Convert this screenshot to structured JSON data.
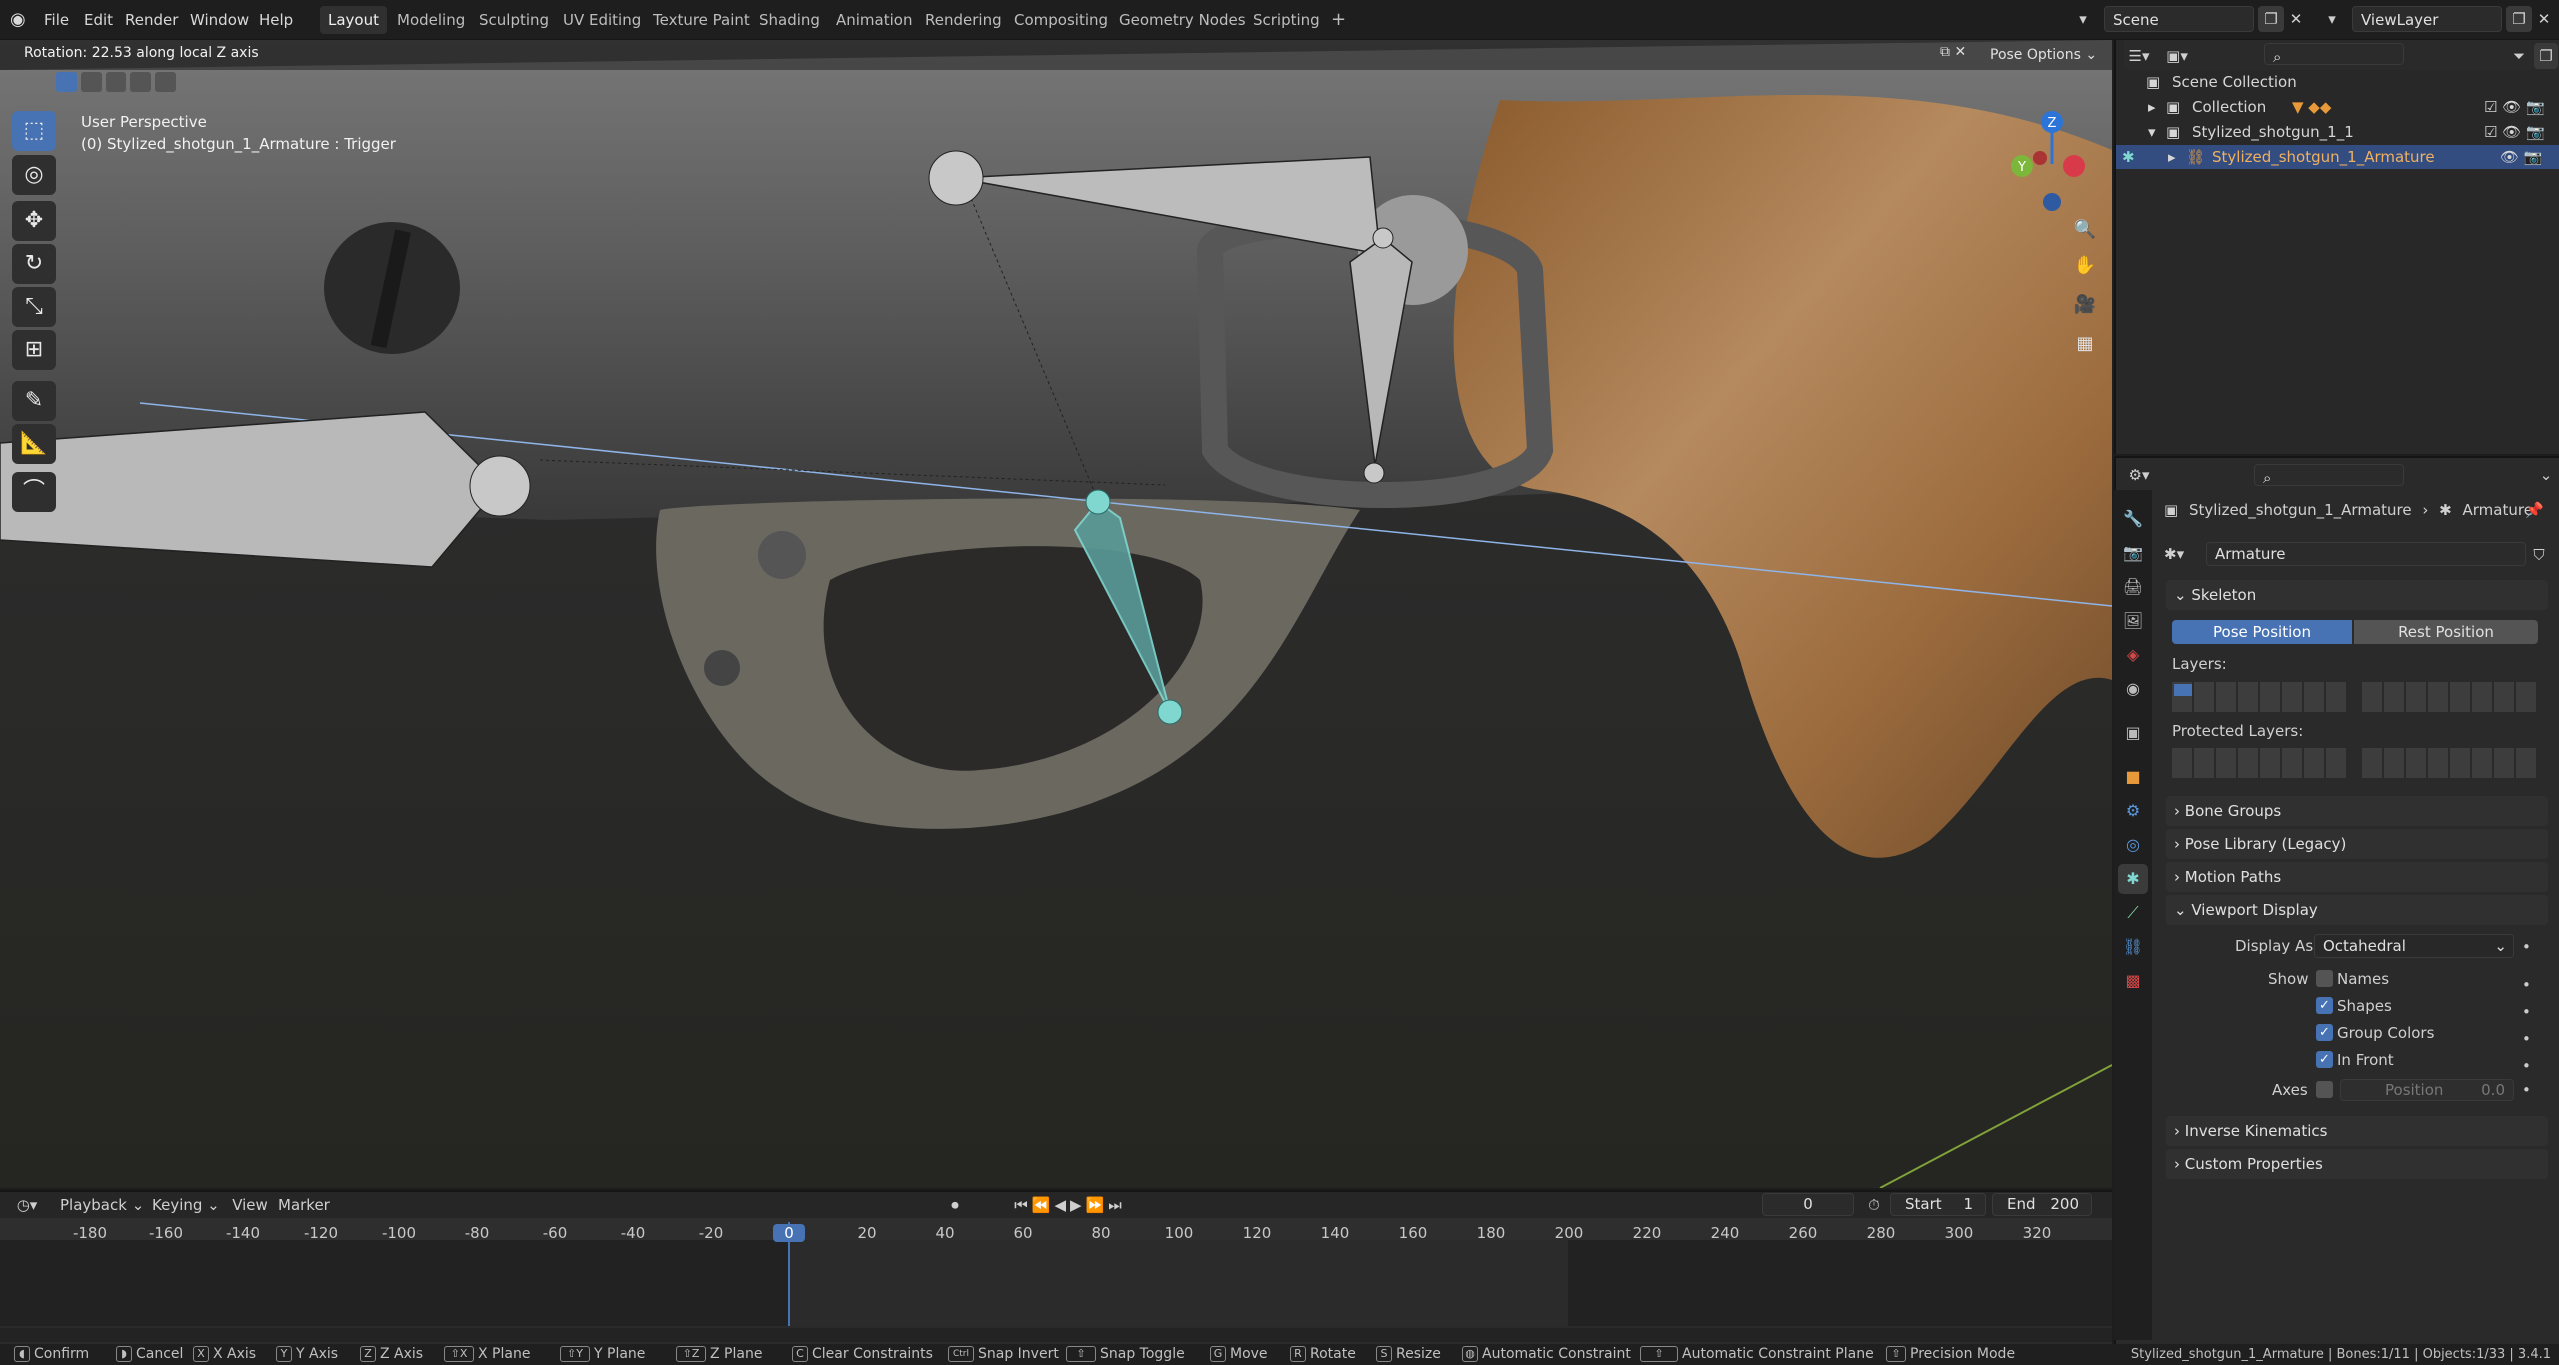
{
  "menu": {
    "app_icon": "blender-logo-icon",
    "file": "File",
    "edit": "Edit",
    "render": "Render",
    "window": "Window",
    "help": "Help"
  },
  "workspaces": [
    "Layout",
    "Modeling",
    "Sculpting",
    "UV Editing",
    "Texture Paint",
    "Shading",
    "Animation",
    "Rendering",
    "Compositing",
    "Geometry Nodes",
    "Scripting"
  ],
  "scene": {
    "name": "Scene",
    "viewlayer": "ViewLayer"
  },
  "viewport": {
    "operator_info": "Rotation: 22.53 along local Z axis",
    "perspective": "User Perspective",
    "active": "(0) Stylized_shotgun_1_Armature : Trigger",
    "pose_options": "Pose Options",
    "gizmo": {
      "z": "Z",
      "y": "Y"
    }
  },
  "outliner": {
    "items": [
      {
        "label": "Scene Collection"
      },
      {
        "label": "Collection"
      },
      {
        "label": "Stylized_shotgun_1_1"
      },
      {
        "label": "Stylized_shotgun_1_Armature"
      }
    ]
  },
  "properties": {
    "breadcrumb_object": "Stylized_shotgun_1_Armature",
    "breadcrumb_data": "Armature",
    "data_name": "Armature",
    "skeleton": {
      "title": "Skeleton",
      "pose_position": "Pose Position",
      "rest_position": "Rest Position",
      "layers": "Layers:",
      "protected_layers": "Protected Layers:"
    },
    "collapsed_panels": [
      "Bone Groups",
      "Pose Library (Legacy)",
      "Motion Paths"
    ],
    "viewport_display": {
      "title": "Viewport Display",
      "display_as_label": "Display As",
      "display_as_value": "Octahedral",
      "show_label": "Show",
      "names": "Names",
      "names_checked": false,
      "shapes": "Shapes",
      "shapes_checked": true,
      "group_colors": "Group Colors",
      "group_colors_checked": true,
      "in_front": "In Front",
      "in_front_checked": true,
      "axes_label": "Axes",
      "axes_position_label": "Position",
      "axes_position_value": "0.0"
    },
    "bottom_panels": [
      "Inverse Kinematics",
      "Custom Properties"
    ]
  },
  "timeline": {
    "playback": "Playback",
    "keying": "Keying",
    "view": "View",
    "marker": "Marker",
    "current_frame": "0",
    "start_label": "Start",
    "start": "1",
    "end_label": "End",
    "end": "200",
    "ticks": [
      "-180",
      "-160",
      "-140",
      "-120",
      "-100",
      "-80",
      "-60",
      "-40",
      "-20",
      "0",
      "20",
      "40",
      "60",
      "80",
      "100",
      "120",
      "140",
      "160",
      "180",
      "200",
      "220",
      "240",
      "260",
      "280",
      "300",
      "320"
    ]
  },
  "statusbar": {
    "items": [
      {
        "key": "",
        "label": "Confirm"
      },
      {
        "key": "",
        "label": "Cancel"
      },
      {
        "key": "X",
        "label": "X Axis"
      },
      {
        "key": "Y",
        "label": "Y Axis"
      },
      {
        "key": "Z",
        "label": "Z Axis"
      },
      {
        "key": "⇧X",
        "label": "X Plane"
      },
      {
        "key": "⇧Y",
        "label": "Y Plane"
      },
      {
        "key": "⇧Z",
        "label": "Z Plane"
      },
      {
        "key": "C",
        "label": "Clear Constraints"
      },
      {
        "key": "Ctrl",
        "label": "Snap Invert"
      },
      {
        "key": "⇧",
        "label": "Snap Toggle"
      },
      {
        "key": "G",
        "label": "Move"
      },
      {
        "key": "R",
        "label": "Rotate"
      },
      {
        "key": "S",
        "label": "Resize"
      },
      {
        "key": "",
        "label": "Automatic Constraint"
      },
      {
        "key": "⇧",
        "label": "Automatic Constraint Plane"
      },
      {
        "key": "⇧",
        "label": "Precision Mode"
      }
    ],
    "stats": "Stylized_shotgun_1_Armature | Bones:1/11 | Objects:1/33 | 3.4.1"
  },
  "colors": {
    "accent": "#4772b3",
    "selected_bone": "#7fd7d0",
    "header": "#1e1e1e"
  }
}
